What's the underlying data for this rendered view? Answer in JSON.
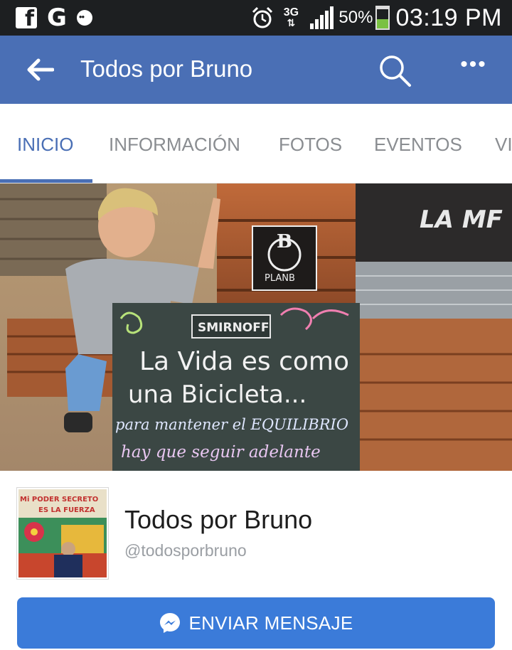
{
  "status_bar": {
    "network": "3G",
    "battery_percent": "50%",
    "battery_level": 0.5,
    "time": "03:19 PM",
    "icons": [
      "facebook-icon",
      "google-icon",
      "messenger-notification-icon",
      "alarm-icon",
      "network-3g-icon",
      "signal-icon",
      "battery-icon"
    ]
  },
  "app_bar": {
    "title": "Todos por Bruno",
    "icons": [
      "back-arrow-icon",
      "search-icon",
      "more-icon"
    ]
  },
  "tabs": [
    {
      "label": "INICIO",
      "active": true
    },
    {
      "label": "INFORMACIÓN",
      "active": false
    },
    {
      "label": "FOTOS",
      "active": false
    },
    {
      "label": "EVENTOS",
      "active": false
    },
    {
      "label": "VI",
      "active": false
    }
  ],
  "cover": {
    "sign_brand": "SMIRNOFF",
    "sign_line1": "La Vida es como",
    "sign_line2": "una Bicicleta...",
    "sign_line3": "para mantener el EQUILIBRIO",
    "sign_line4": "hay que seguir adelante",
    "logo_text": "PLANB",
    "banner_text": "LA MF"
  },
  "avatar": {
    "line1": "Mi PODER SECRETO",
    "line2": "ES LA FUERZA"
  },
  "profile": {
    "name": "Todos por Bruno",
    "handle": "@todosporbruno"
  },
  "send_button": {
    "label": "ENVIAR MENSAJE",
    "icon": "messenger-icon"
  },
  "colors": {
    "app_bar": "#4a6fb5",
    "tab_active": "#4a6fb5",
    "button": "#3b7bd9",
    "status_bar": "#1d1f21"
  }
}
